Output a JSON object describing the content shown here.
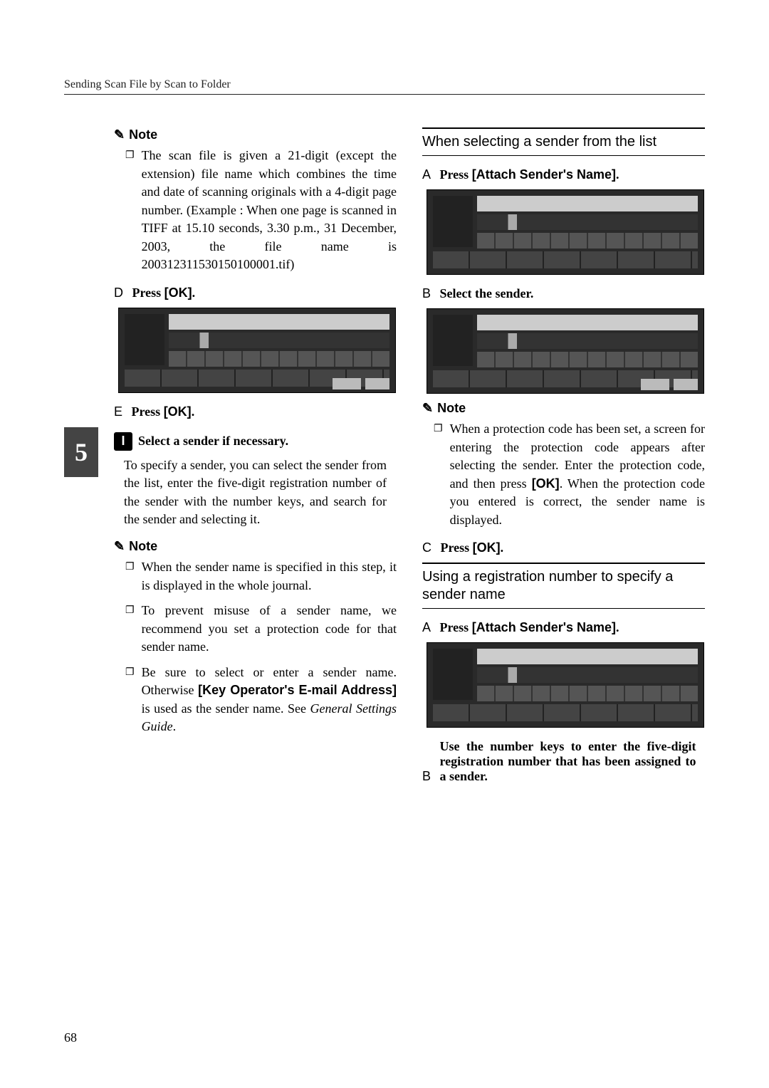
{
  "header": "Sending Scan File by Scan to Folder",
  "side_tab": "5",
  "page_number": "68",
  "left": {
    "note_label": "Note",
    "note1_bullet": "❐",
    "note1": "The scan file is given a 21-digit (except the extension) file name which combines the time and date of scanning originals with a 4-digit page number. (Example : When one page is scanned in TIFF at 15.10 seconds, 3.30 p.m., 31 December, 2003, the file name is 200312311530150100001.tif)",
    "stepD_letter": "D",
    "stepD_label_pre": "Press ",
    "stepD_btn": "[OK]",
    "stepD_post": ".",
    "stepE_letter": "E",
    "stepE_label_pre": "Press ",
    "stepE_btn": "[OK]",
    "stepE_post": ".",
    "step9_num": "I",
    "step9_text": "Select a sender if necessary.",
    "para1": "To specify a sender, you can select the sender from the list, enter the five-digit registration number of the sender with the number keys, and search for the sender and selecting it.",
    "note2_label": "Note",
    "n2a_bullet": "❐",
    "n2a": "When the sender name is specified in this step, it is displayed in the whole journal.",
    "n2b_bullet": "❐",
    "n2b": "To prevent misuse of a sender name, we recommend you set a protection code for that sender name.",
    "n2c_bullet": "❐",
    "n2c_pre": "Be sure to select or enter a sender name. Otherwise ",
    "n2c_btn": "[Key Operator's E-mail Address]",
    "n2c_mid": " is used as the sender name. See ",
    "n2c_ital": "General Settings Guide",
    "n2c_post": "."
  },
  "right": {
    "section1": "When selecting a sender from the list",
    "s1A_letter": "A",
    "s1A_pre": "Press ",
    "s1A_btn": "[Attach Sender's Name]",
    "s1A_post": ".",
    "s1B_letter": "B",
    "s1B_text": "Select the sender.",
    "note_label": "Note",
    "note_bullet": "❐",
    "note_body_pre": "When a protection code has been set, a screen for entering the protection code appears after selecting the sender. Enter the protection code, and then press ",
    "note_body_btn": "[OK]",
    "note_body_post": ". When the protection code you entered is correct, the sender name is displayed.",
    "s1C_letter": "C",
    "s1C_pre": "Press ",
    "s1C_btn": "[OK]",
    "s1C_post": ".",
    "section2": "Using a registration number to specify a sender name",
    "s2A_letter": "A",
    "s2A_pre": "Press ",
    "s2A_btn": "[Attach Sender's Name]",
    "s2A_post": ".",
    "s2B_letter": "B",
    "s2B_text": "Use the number keys to enter the five-digit registration number that has been assigned to a sender."
  }
}
